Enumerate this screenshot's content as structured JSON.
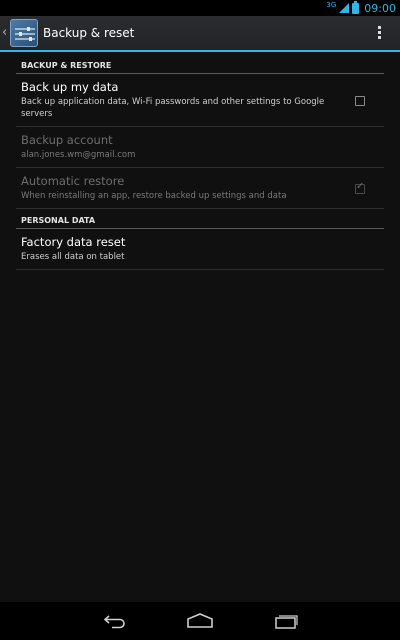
{
  "status_bar": {
    "network": "3G",
    "time": "09:00",
    "colors": {
      "accent": "#33b5e5"
    }
  },
  "action_bar": {
    "title": "Backup & reset",
    "icon": "settings-sliders-icon"
  },
  "sections": {
    "backup_restore": {
      "header": "BACKUP & RESTORE",
      "backup_my_data": {
        "title": "Back up my data",
        "summary": "Back up application data, Wi-Fi passwords and other settings to Google servers",
        "checked": false
      },
      "backup_account": {
        "title": "Backup account",
        "summary": "alan.jones.wm@gmail.com",
        "enabled": false
      },
      "automatic_restore": {
        "title": "Automatic restore",
        "summary": "When reinstalling an app, restore backed up settings and data",
        "checked": true,
        "enabled": false
      }
    },
    "personal_data": {
      "header": "PERSONAL DATA",
      "factory_reset": {
        "title": "Factory data reset",
        "summary": "Erases all data on tablet"
      }
    }
  },
  "nav_bar": {
    "buttons": [
      "back-icon",
      "home-icon",
      "recent-apps-icon"
    ]
  }
}
